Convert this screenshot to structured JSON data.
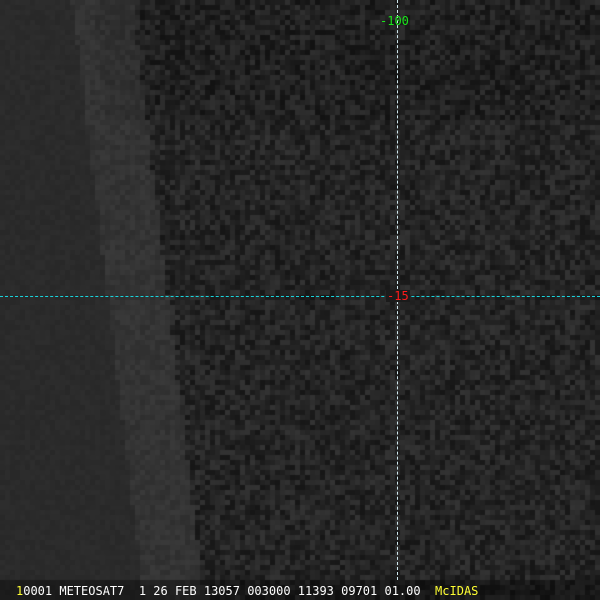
{
  "image": {
    "lon_label": "-100",
    "lat_label": "-15",
    "colors": {
      "lon_label": "#19e619",
      "lat_label": "#ff1a1a",
      "grid_lat": "#19d3dc",
      "grid_lon": "#cfe8ee"
    }
  },
  "footer": {
    "frame_number": "1",
    "info": "0001 METEOSAT7  1 26 FEB 13057 003000 11393 09701 01.00",
    "brand": "McIDAS"
  }
}
